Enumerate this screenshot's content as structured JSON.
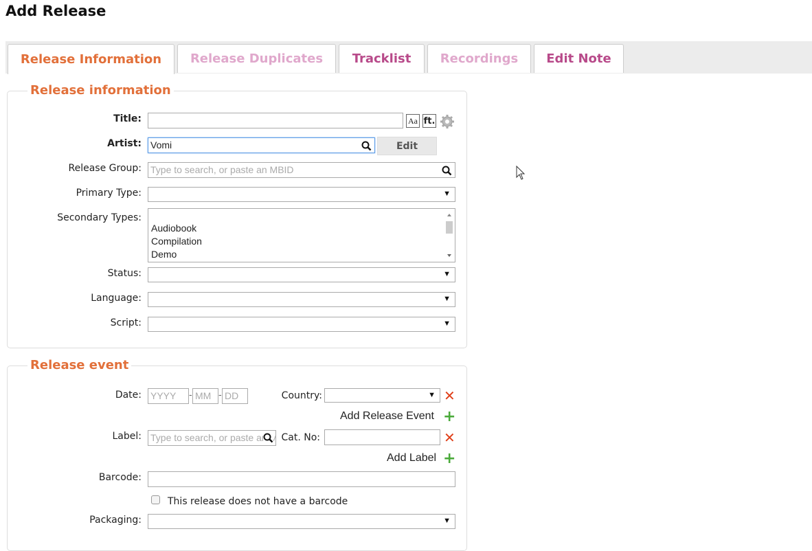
{
  "page": {
    "title": "Add Release"
  },
  "tabs": [
    {
      "label": "Release Information",
      "state": "active"
    },
    {
      "label": "Release Duplicates",
      "state": "disabled"
    },
    {
      "label": "Tracklist",
      "state": "normal"
    },
    {
      "label": "Recordings",
      "state": "disabled"
    },
    {
      "label": "Edit Note",
      "state": "normal"
    }
  ],
  "release_info": {
    "legend": "Release information",
    "title_label": "Title:",
    "title_value": "",
    "guess_case_icon": "Aa",
    "ft_icon": "ft.",
    "artist_label": "Artist:",
    "artist_value": "Vomi",
    "edit_button": "Edit",
    "release_group_label": "Release Group:",
    "release_group_placeholder": "Type to search, or paste an MBID",
    "primary_type_label": "Primary Type:",
    "primary_type_value": "",
    "secondary_types_label": "Secondary Types:",
    "secondary_types_options": [
      "",
      "Audiobook",
      "Compilation",
      "Demo"
    ],
    "status_label": "Status:",
    "language_label": "Language:",
    "script_label": "Script:"
  },
  "release_event": {
    "legend": "Release event",
    "date_label": "Date:",
    "year_placeholder": "YYYY",
    "month_placeholder": "MM",
    "day_placeholder": "DD",
    "date_sep": "-",
    "country_label": "Country:",
    "add_release_event": "Add Release Event",
    "label_label": "Label:",
    "label_placeholder": "Type to search, or paste an MBID",
    "cat_no_label": "Cat. No:",
    "add_label": "Add Label",
    "barcode_label": "Barcode:",
    "no_barcode_label": "This release does not have a barcode",
    "packaging_label": "Packaging:"
  },
  "colors": {
    "accent": "#e2703a",
    "tab_link": "#b84a8a",
    "tab_disabled": "#e0a8cc",
    "remove": "#e0401a",
    "add": "#4aaa3a"
  }
}
